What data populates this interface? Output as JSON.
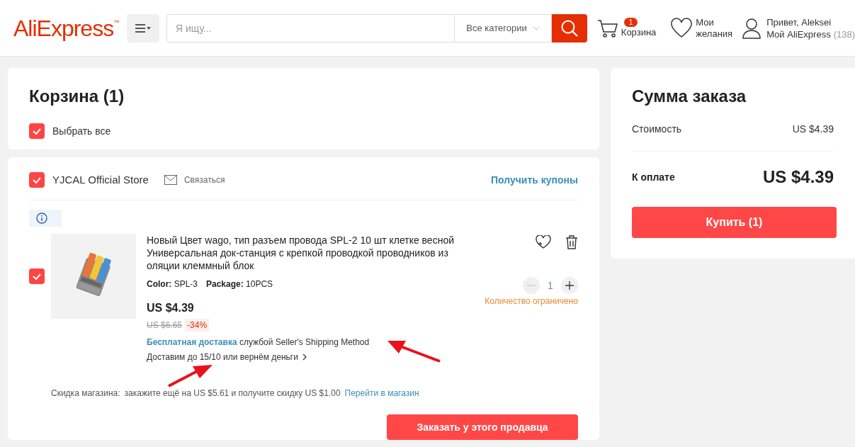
{
  "header": {
    "logo": "AliExpress",
    "logo_mark": "™",
    "search": {
      "placeholder": "Я ищу...",
      "category": "Все категории"
    },
    "cart": {
      "label": "Корзина",
      "count": "1"
    },
    "wishlist": {
      "line1": "Мои",
      "line2": "желания"
    },
    "account": {
      "greeting": "Привет, Aleksei",
      "link": "Мой AliExpress",
      "count": "(138)"
    }
  },
  "cart": {
    "title": "Корзина (1)",
    "select_all": {
      "label": "Выбрать все",
      "checked": true
    }
  },
  "store": {
    "name": "YJCAL Official Store",
    "checked": true,
    "contact": "Связаться",
    "coupons": "Получить купоны",
    "item": {
      "checked": true,
      "title": "Новый Цвет wago, тип разъем провода SPL-2 10 шт клетке весной Универсальная док-станция с крепкой проводкой проводников из оляции клеммный блок",
      "props": [
        {
          "name": "Color:",
          "value": "SPL-3"
        },
        {
          "name": "Package:",
          "value": "10PCS"
        }
      ],
      "price": "US $4.39",
      "old_price": "US $6.65",
      "discount": "-34%",
      "shipping_free": "Бесплатная доставка",
      "shipping_method": "службой Seller's Shipping Method",
      "delivery": "Доставим до 15/10 или вернём деньги",
      "quantity": "1",
      "decrease_disabled": true,
      "limit_note": "Количество ограничено"
    },
    "promo": {
      "label": "Скидка магазина:",
      "text": "закажите ещё на US $5.61 и получите скидку US $1.00",
      "link": "Перейти в магазин"
    },
    "order_button": "Заказать у этого продавца"
  },
  "summary": {
    "title": "Сумма заказа",
    "cost_label": "Стоимость",
    "cost": "US $4.39",
    "total_label": "К оплате",
    "total": "US $4.39",
    "buy_button": "Купить (1)"
  }
}
